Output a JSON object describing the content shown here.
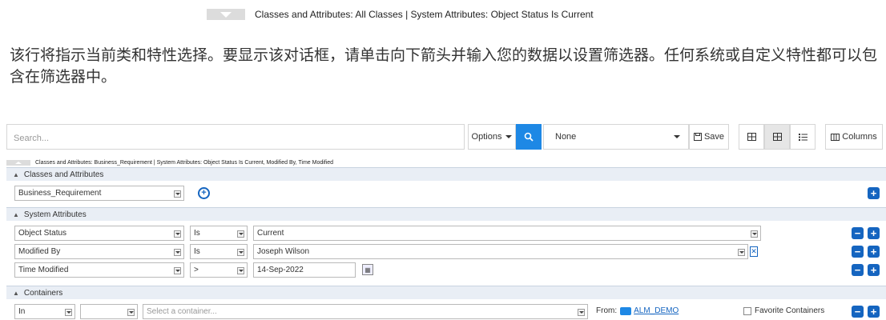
{
  "top_summary": {
    "text": "Classes and Attributes: All Classes | System Attributes: Object Status Is Current"
  },
  "description": "该行将指示当前类和特性选择。要显示该对话框，请单击向下箭头并输入您的数据以设置筛选器。任何系统或自定义特性都可以包含在筛选器中。",
  "toolbar": {
    "search_placeholder": "Search...",
    "options_label": "Options",
    "filter_value": "None",
    "save_label": "Save",
    "columns_label": "Columns"
  },
  "summary_bar": {
    "text": "Classes and Attributes: Business_Requirement | System Attributes: Object Status Is Current, Modified By, Time Modified"
  },
  "sections": {
    "classes": {
      "title": "Classes and Attributes",
      "class_value": "Business_Requirement"
    },
    "system": {
      "title": "System Attributes",
      "rows": [
        {
          "attribute": "Object Status",
          "operator": "Is",
          "value": "Current"
        },
        {
          "attribute": "Modified By",
          "operator": "Is",
          "value": "Joseph Wilson"
        },
        {
          "attribute": "Time Modified",
          "operator": ">",
          "value": "14-Sep-2022"
        }
      ]
    },
    "containers": {
      "title": "Containers",
      "scope": "In",
      "second": "",
      "container_placeholder": "Select a container...",
      "from_label": "From:",
      "from_link": "ALM_DEMO",
      "favorite_label": "Favorite Containers"
    }
  },
  "icons": {
    "search": "search-icon",
    "save": "save-icon",
    "columns": "columns-icon",
    "add": "plus-icon",
    "remove": "minus-icon"
  },
  "colors": {
    "accent": "#1e88e5",
    "button_dark": "#1565c0",
    "section_header": "#e9eef5"
  }
}
